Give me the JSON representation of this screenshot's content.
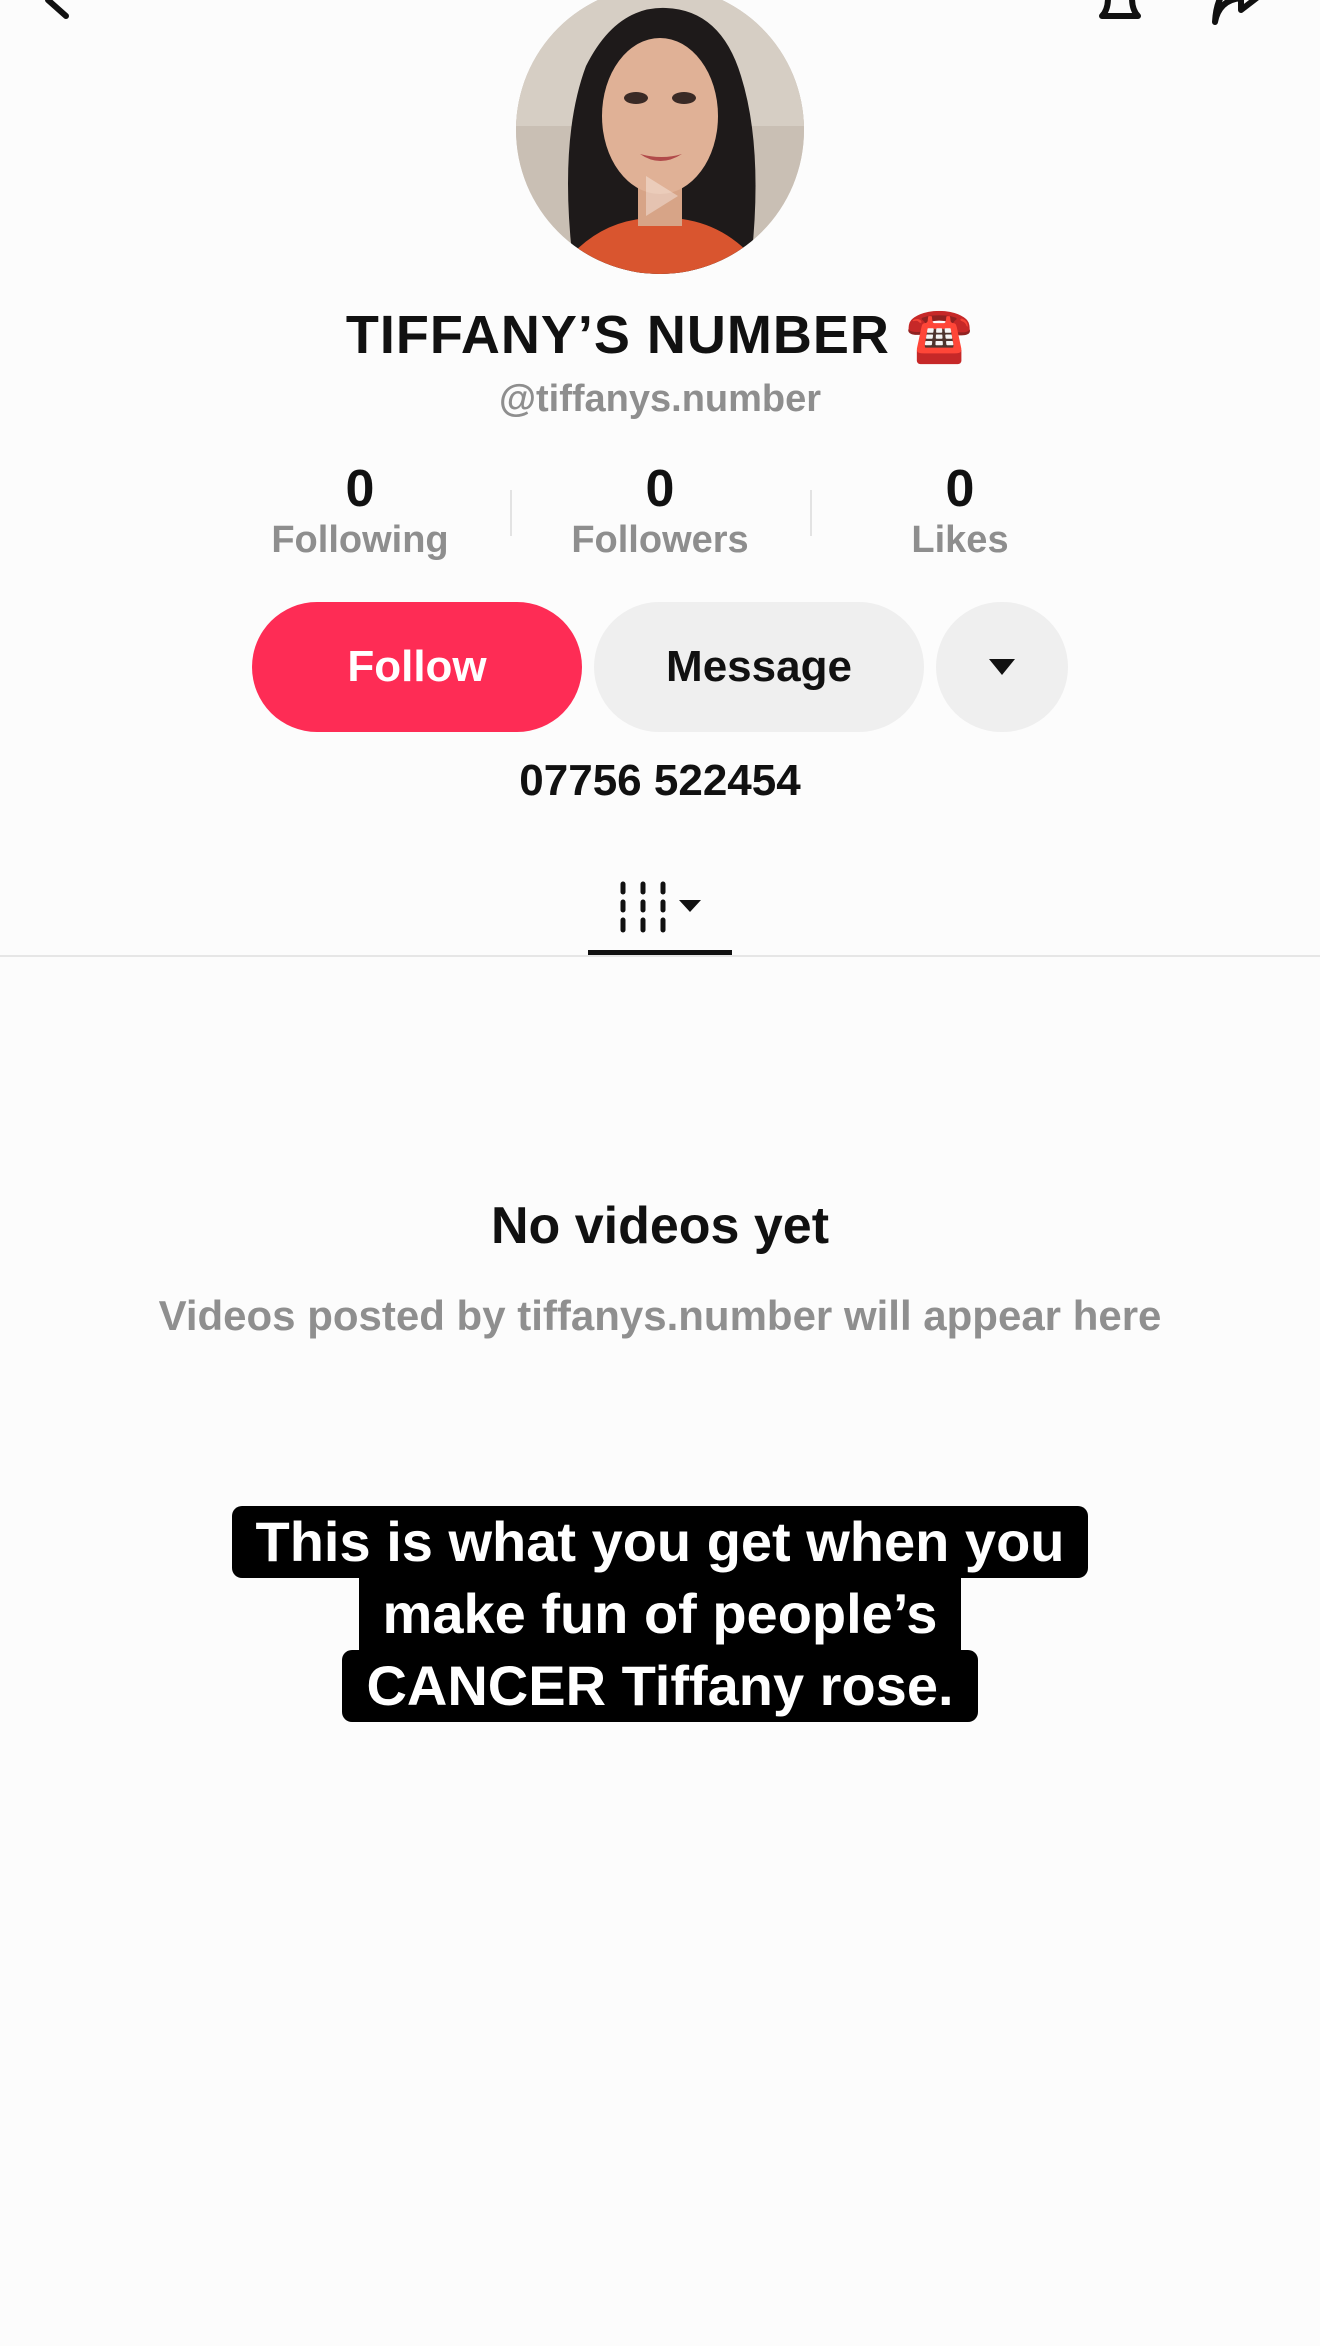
{
  "profile": {
    "display_name": "TIFFANY’S NUMBER",
    "name_emoji": "☎️",
    "username": "@tiffanys.number",
    "bio": "07756 522454"
  },
  "stats": [
    {
      "value": "0",
      "label": "Following"
    },
    {
      "value": "0",
      "label": "Followers"
    },
    {
      "value": "0",
      "label": "Likes"
    }
  ],
  "actions": {
    "follow_label": "Follow",
    "message_label": "Message"
  },
  "empty_state": {
    "title": "No videos yet",
    "subtitle": "Videos posted by tiffanys.number will appear here"
  },
  "caption": {
    "lines": [
      "This is what you get when you",
      "make fun of people’s",
      "CANCER Tiffany rose."
    ]
  },
  "icons": {
    "back": "back-arrow-icon",
    "bell": "bell-icon",
    "share": "share-icon",
    "more": "caret-down-icon",
    "videos_tab": "video-grid-icon"
  },
  "colors": {
    "follow_button": "#fe2c55",
    "secondary_button": "#efefef",
    "muted_text": "#8e8e8e"
  }
}
